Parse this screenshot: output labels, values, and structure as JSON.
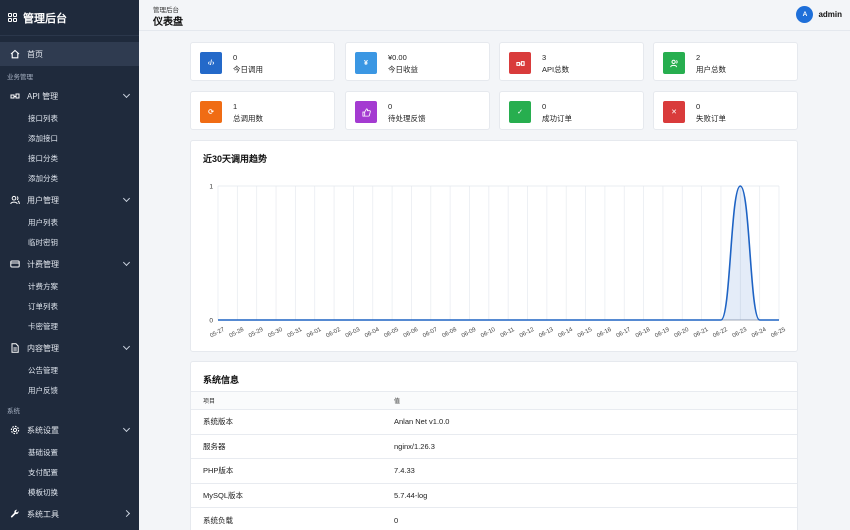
{
  "brand": {
    "title": "管理后台"
  },
  "header": {
    "breadcrumb": "管理后台",
    "title": "仪表盘",
    "avatar_letter": "A",
    "username": "admin"
  },
  "sidebar": {
    "home": "首页",
    "section_business": "业务管理",
    "api": {
      "label": "API 管理",
      "items": [
        "接口列表",
        "添加接口",
        "接口分类",
        "添加分类"
      ]
    },
    "users": {
      "label": "用户管理",
      "items": [
        "用户列表",
        "临时密钥"
      ]
    },
    "billing": {
      "label": "计费管理",
      "items": [
        "计费方案",
        "订单列表",
        "卡密管理"
      ]
    },
    "content": {
      "label": "内容管理",
      "items": [
        "公告管理",
        "用户反馈"
      ]
    },
    "section_system": "系统",
    "settings": {
      "label": "系统设置",
      "items": [
        "基础设置",
        "支付配置",
        "模板切换"
      ]
    },
    "tools": {
      "label": "系统工具"
    }
  },
  "stats": [
    {
      "value": "0",
      "label": "今日调用",
      "color": "#2469c9",
      "icon": "code-icon"
    },
    {
      "value": "¥0.00",
      "label": "今日收益",
      "color": "#3b97e3",
      "icon": "yen-icon"
    },
    {
      "value": "3",
      "label": "API总数",
      "color": "#d93b3b",
      "icon": "plug-icon"
    },
    {
      "value": "2",
      "label": "用户总数",
      "color": "#27ae4f",
      "icon": "users-icon"
    },
    {
      "value": "1",
      "label": "总调用数",
      "color": "#f06c14",
      "icon": "refresh-icon"
    },
    {
      "value": "0",
      "label": "待处理反馈",
      "color": "#a43bd1",
      "icon": "thumb-icon"
    },
    {
      "value": "0",
      "label": "成功订单",
      "color": "#27ae4f",
      "icon": "check-icon"
    },
    {
      "value": "0",
      "label": "失败订单",
      "color": "#d93b3b",
      "icon": "close-icon"
    }
  ],
  "chart_panel": {
    "title": "近30天调用趋势"
  },
  "chart_data": {
    "type": "line",
    "x": [
      "05-27",
      "05-28",
      "05-29",
      "05-30",
      "05-31",
      "06-01",
      "06-02",
      "06-03",
      "06-04",
      "06-05",
      "06-06",
      "06-07",
      "06-08",
      "06-09",
      "06-10",
      "06-11",
      "06-12",
      "06-13",
      "06-14",
      "06-15",
      "06-16",
      "06-17",
      "06-18",
      "06-19",
      "06-20",
      "06-21",
      "06-22",
      "06-23",
      "06-24",
      "06-25"
    ],
    "series": [
      {
        "values": [
          0,
          0,
          0,
          0,
          0,
          0,
          0,
          0,
          0,
          0,
          0,
          0,
          0,
          0,
          0,
          0,
          0,
          0,
          0,
          0,
          0,
          0,
          0,
          0,
          0,
          0,
          0,
          1,
          0,
          0
        ]
      }
    ],
    "yticks": [
      "0",
      "1"
    ],
    "ylim": [
      0,
      1
    ],
    "grid": true,
    "color": "#1e63c4"
  },
  "system_info": {
    "title": "系统信息",
    "headers": [
      "项目",
      "值"
    ],
    "rows": [
      [
        "系统版本",
        "Anlan Net v1.0.0"
      ],
      [
        "服务器",
        "nginx/1.26.3"
      ],
      [
        "PHP版本",
        "7.4.33"
      ],
      [
        "MySQL版本",
        "5.7.44-log"
      ],
      [
        "系统负载",
        "0"
      ]
    ]
  }
}
